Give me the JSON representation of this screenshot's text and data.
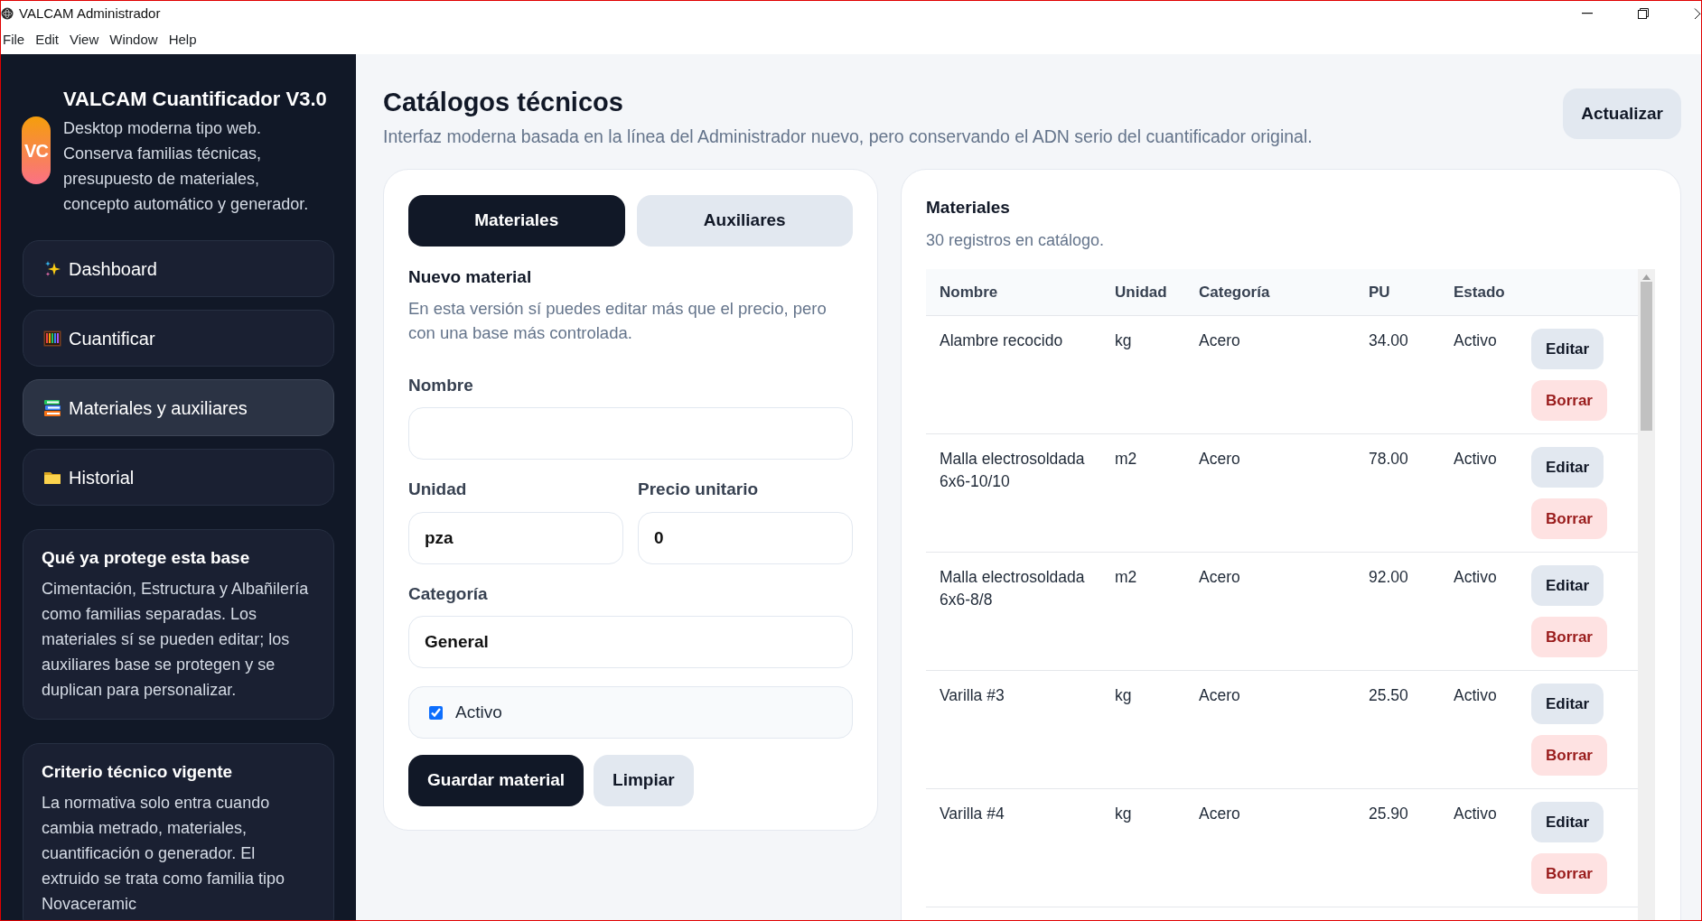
{
  "window": {
    "title": "VALCAM Administrador"
  },
  "menu": [
    "File",
    "Edit",
    "View",
    "Window",
    "Help"
  ],
  "sidebar": {
    "brand": {
      "logo": "VC",
      "title": "VALCAM Cuantificador V3.0",
      "subtitle": "Desktop moderna tipo web. Conserva familias técnicas, presupuesto de materiales, concepto automático y generador."
    },
    "nav": [
      {
        "label": "Dashboard",
        "selected": false
      },
      {
        "label": "Cuantificar",
        "selected": false
      },
      {
        "label": "Materiales y auxiliares",
        "selected": true
      },
      {
        "label": "Historial",
        "selected": false
      }
    ],
    "info_cards": [
      {
        "title": "Qué ya protege esta base",
        "text": "Cimentación, Estructura y Albañilería como familias separadas. Los materiales sí se pueden editar; los auxiliares base se protegen y se duplican para personalizar."
      },
      {
        "title": "Criterio técnico vigente",
        "text": "La normativa solo entra cuando cambia metrado, materiales, cuantificación o generador. El extruido se trata como familia tipo Novaceramic"
      }
    ]
  },
  "header": {
    "title": "Catálogos técnicos",
    "subtitle": "Interfaz moderna basada en la línea del Administrador nuevo, pero conservando el ADN serio del cuantificador original.",
    "refresh_button": "Actualizar"
  },
  "form": {
    "tabs": [
      {
        "label": "Materiales",
        "selected": true
      },
      {
        "label": "Auxiliares",
        "selected": false
      }
    ],
    "title": "Nuevo material",
    "description": "En esta versión sí puedes editar más que el precio, pero con una base más controlada.",
    "field_rows": [
      [
        {
          "label": "Nombre"
        }
      ],
      [
        {
          "label": "Unidad",
          "value": "pza"
        },
        {
          "label": "Precio unitario",
          "value": "0"
        }
      ],
      [
        {
          "label": "Categoría",
          "value": "General"
        }
      ]
    ],
    "checkbox": {
      "label": "Activo",
      "checked": true
    },
    "buttons": [
      {
        "label": "Guardar material",
        "kind": "primary"
      },
      {
        "label": "Limpiar",
        "kind": "secondary"
      }
    ]
  },
  "table_panel": {
    "title": "Materiales",
    "subtitle": "30 registros en catálogo.",
    "columns": [
      "Nombre",
      "Unidad",
      "Categoría",
      "PU",
      "Estado"
    ],
    "rows": [
      {
        "cells": [
          "Alambre recocido",
          "kg",
          "Acero",
          "34.00",
          "Activo"
        ],
        "actions": [
          {
            "label": "Editar",
            "kind": "edit"
          },
          {
            "label": "Borrar",
            "kind": "delete"
          }
        ]
      },
      {
        "cells": [
          "Malla electrosoldada 6x6-10/10",
          "m2",
          "Acero",
          "78.00",
          "Activo"
        ],
        "actions": [
          {
            "label": "Editar",
            "kind": "edit"
          },
          {
            "label": "Borrar",
            "kind": "delete"
          }
        ]
      },
      {
        "cells": [
          "Malla electrosoldada 6x6-8/8",
          "m2",
          "Acero",
          "92.00",
          "Activo"
        ],
        "actions": [
          {
            "label": "Editar",
            "kind": "edit"
          },
          {
            "label": "Borrar",
            "kind": "delete"
          }
        ]
      },
      {
        "cells": [
          "Varilla #3",
          "kg",
          "Acero",
          "25.50",
          "Activo"
        ],
        "actions": [
          {
            "label": "Editar",
            "kind": "edit"
          },
          {
            "label": "Borrar",
            "kind": "delete"
          }
        ]
      },
      {
        "cells": [
          "Varilla #4",
          "kg",
          "Acero",
          "25.90",
          "Activo"
        ],
        "actions": [
          {
            "label": "Editar",
            "kind": "edit"
          },
          {
            "label": "Borrar",
            "kind": "delete"
          }
        ]
      }
    ]
  }
}
